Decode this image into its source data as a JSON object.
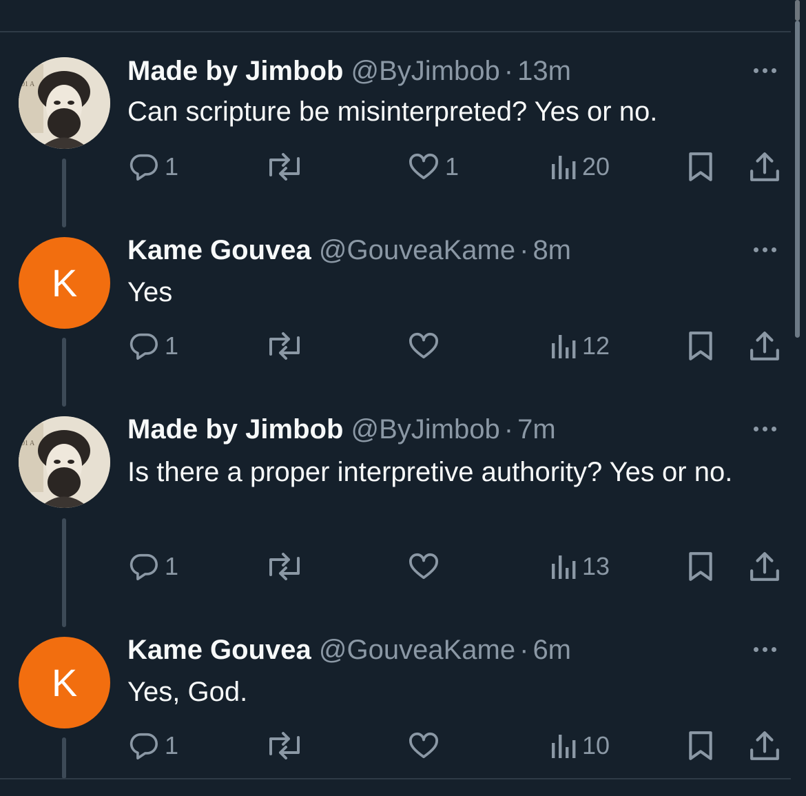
{
  "colors": {
    "background": "#15202b",
    "text": "#f7f9f9",
    "muted": "#8b98a5",
    "avatar_k": "#f26e0f"
  },
  "tweets": [
    {
      "name": "Made by Jimbob",
      "handle": "@ByJimbob",
      "separator": "·",
      "time": "13m",
      "text": "Can scripture be misinterpreted? Yes or no.",
      "avatar": "photo",
      "avatar_inset_text": "01 A",
      "replies": "1",
      "retweets": "",
      "likes": "1",
      "views": "20"
    },
    {
      "name": "Kame Gouvea",
      "handle": "@GouveaKame",
      "separator": "·",
      "time": "8m",
      "text": "Yes",
      "avatar": "letter",
      "avatar_letter": "K",
      "replies": "1",
      "retweets": "",
      "likes": "",
      "views": "12"
    },
    {
      "name": "Made by Jimbob",
      "handle": "@ByJimbob",
      "separator": "·",
      "time": "7m",
      "text": "Is there a proper interpretive authority? Yes or no.",
      "avatar": "photo",
      "avatar_inset_text": "01 A",
      "replies": "1",
      "retweets": "",
      "likes": "",
      "views": "13"
    },
    {
      "name": "Kame Gouvea",
      "handle": "@GouveaKame",
      "separator": "·",
      "time": "6m",
      "text": "Yes, God.",
      "avatar": "letter",
      "avatar_letter": "K",
      "replies": "1",
      "retweets": "",
      "likes": "",
      "views": "10"
    }
  ],
  "icons": {
    "reply": "reply-bubble-icon",
    "retweet": "retweet-icon",
    "like": "heart-icon",
    "views": "views-bar-chart-icon",
    "bookmark": "bookmark-icon",
    "share": "share-upload-icon",
    "more": "more-dots-icon"
  }
}
